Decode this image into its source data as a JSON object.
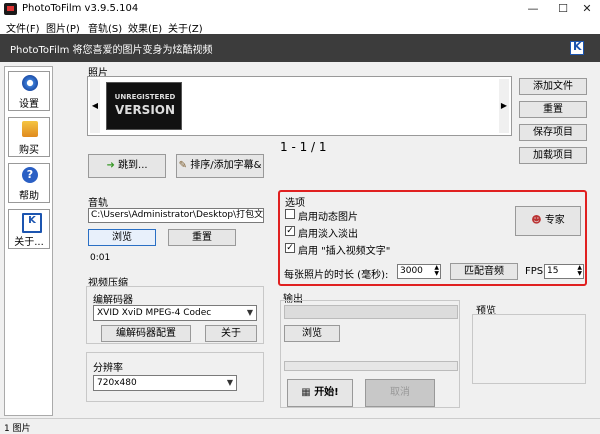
{
  "window": {
    "title": "PhotoToFilm v3.9.5.104",
    "controls": {
      "minimize": "—",
      "maximize": "☐",
      "close": "✕"
    }
  },
  "menu": [
    "文件(F)",
    "图片(P)",
    "音轨(S)",
    "效果(E)",
    "关于(Z)"
  ],
  "banner": {
    "text": "PhotoToFilm  将您喜爱的图片变身为炫酷视频"
  },
  "sidebar": [
    {
      "label": "设置",
      "icon": "gear-icon"
    },
    {
      "label": "购买",
      "icon": "star-icon"
    },
    {
      "label": "帮助",
      "icon": "help-icon"
    },
    {
      "label": "关于...",
      "icon": "logo-icon"
    }
  ],
  "photos": {
    "label": "照片",
    "thumbnail_text": [
      "UNREGISTERED",
      "VERSION"
    ],
    "counter": "1 - 1 / 1",
    "scroll_left": "◀",
    "scroll_right": "▶",
    "right_buttons": [
      "添加文件",
      "重置",
      "保存项目",
      "加载项目"
    ],
    "goto_button": "跳到...",
    "sort_button": "排序/添加字幕&"
  },
  "audio": {
    "label": "音轨",
    "path": "C:\\Users\\Administrator\\Desktop\\打包文件\\pc",
    "browse": "浏览",
    "reset": "重置",
    "time": "0:01"
  },
  "options": {
    "label": "选项",
    "checks": [
      {
        "label": "启用动态图片",
        "checked": false
      },
      {
        "label": "启用淡入淡出",
        "checked": true
      },
      {
        "label": "启用 \"插入视频文字\"",
        "checked": true
      }
    ],
    "expert": "专家",
    "duration_label": "每张照片的时长 (毫秒):",
    "duration_value": "3000",
    "match_audio": "匹配音频",
    "fps_label": "FPS",
    "fps_value": "15",
    "highlight_color": "#e02020"
  },
  "compression": {
    "label": "视频压缩",
    "codec_label": "编解码器",
    "codec_value": "XVID XviD MPEG-4 Codec",
    "config": "编解码器配置",
    "about": "关于"
  },
  "resolution": {
    "label": "分辨率",
    "value": "720x480"
  },
  "output": {
    "label": "输出",
    "browse": "浏览",
    "start": "开始!",
    "cancel": "取消"
  },
  "preview": {
    "label": "预览"
  },
  "status": "1 图片"
}
